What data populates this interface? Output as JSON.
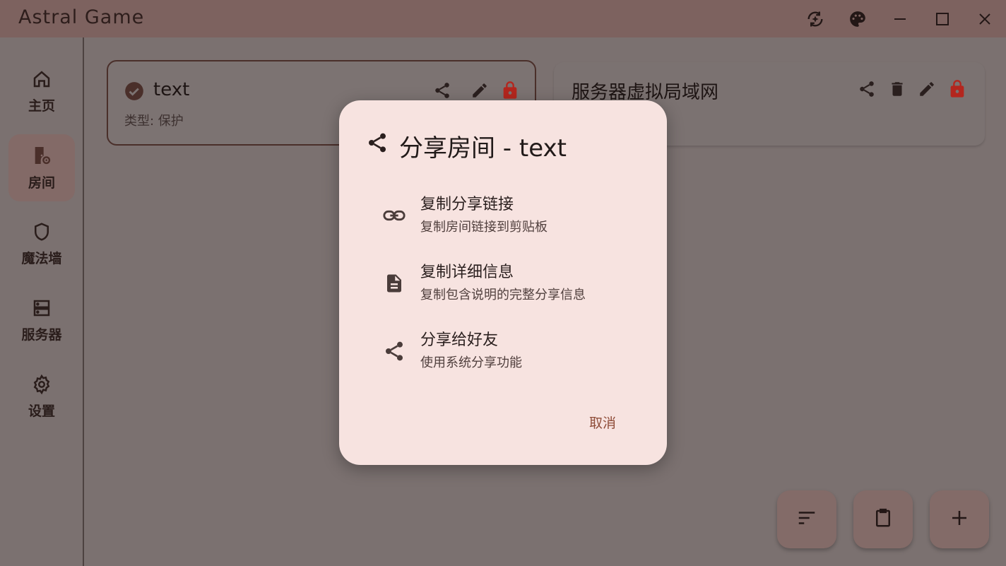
{
  "app": {
    "title": "Astral Game"
  },
  "window_controls": {
    "icons": [
      "sparkle-rotate-icon",
      "palette-icon",
      "minimize-icon",
      "maximize-icon",
      "close-icon"
    ]
  },
  "sidebar": {
    "items": [
      {
        "label": "主页",
        "icon": "home-icon",
        "active": false
      },
      {
        "label": "房间",
        "icon": "room-settings-icon",
        "active": true
      },
      {
        "label": "魔法墙",
        "icon": "shield-icon",
        "active": false
      },
      {
        "label": "服务器",
        "icon": "server-icon",
        "active": false
      },
      {
        "label": "设置",
        "icon": "gear-icon",
        "active": false
      }
    ]
  },
  "rooms": [
    {
      "title": "text",
      "subtitle": "类型: 保护",
      "selected": true
    },
    {
      "title": "服务器虚拟局域网",
      "subtitle": "",
      "selected": false
    }
  ],
  "dialog": {
    "title": "分享房间 - text",
    "options": [
      {
        "title": "复制分享链接",
        "subtitle": "复制房间链接到剪贴板",
        "icon": "link-icon"
      },
      {
        "title": "复制详细信息",
        "subtitle": "复制包含说明的完整分享信息",
        "icon": "document-icon"
      },
      {
        "title": "分享给好友",
        "subtitle": "使用系统分享功能",
        "icon": "share-icon"
      }
    ],
    "cancel": "取消"
  },
  "fabs": {
    "icons": [
      "sort-icon",
      "clipboard-icon",
      "add-icon"
    ]
  },
  "colors": {
    "accent": "#8f4c38",
    "lock": "#b3261e",
    "dialog_bg": "#f7e3e0"
  }
}
